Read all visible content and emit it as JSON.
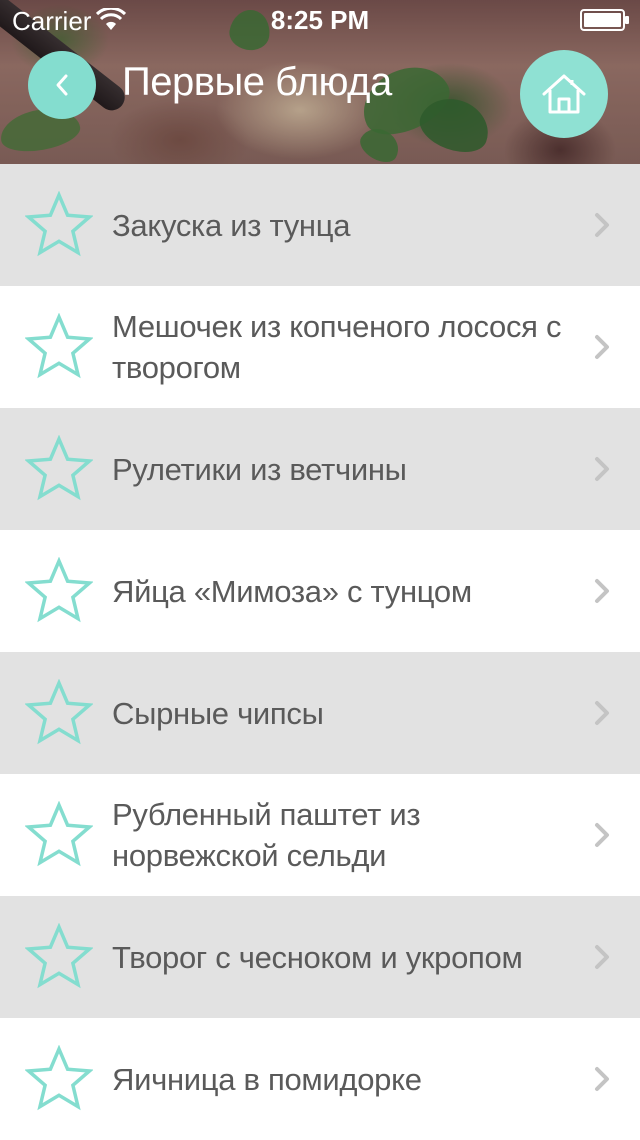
{
  "status_bar": {
    "carrier": "Carrier",
    "time": "8:25 PM"
  },
  "header": {
    "title": "Первые блюда",
    "back_icon": "chevron-left-icon",
    "home_icon": "home-icon",
    "accent_color": "#84ddcf"
  },
  "list": {
    "row_icon": "star-outline-icon",
    "row_icon_color": "#84ddcf",
    "chevron_color": "#c4c4c4",
    "items": [
      {
        "label": "Закуска из тунца"
      },
      {
        "label": "Мешочек из копченого лосося с творогом"
      },
      {
        "label": "Рулетики из ветчины"
      },
      {
        "label": "Яйца «Мимоза» с тунцом"
      },
      {
        "label": "Сырные чипсы"
      },
      {
        "label": "Рубленный паштет из норвежской сельди"
      },
      {
        "label": "Творог с чесноком и укропом"
      },
      {
        "label": "Яичница в помидорке"
      }
    ]
  }
}
